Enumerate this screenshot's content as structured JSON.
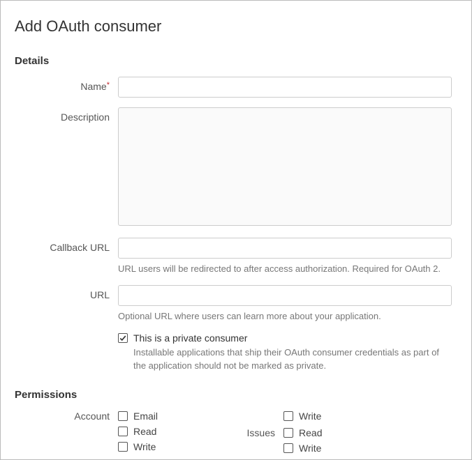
{
  "title": "Add OAuth consumer",
  "sections": {
    "details": {
      "heading": "Details",
      "name": {
        "label": "Name",
        "value": "",
        "required": true
      },
      "description": {
        "label": "Description",
        "value": ""
      },
      "callback_url": {
        "label": "Callback URL",
        "value": "",
        "help": "URL users will be redirected to after access authorization. Required for OAuth 2."
      },
      "url": {
        "label": "URL",
        "value": "",
        "help": "Optional URL where users can learn more about your application."
      },
      "private_consumer": {
        "label": "This is a private consumer",
        "checked": true,
        "help": "Installable applications that ship their OAuth consumer credentials as part of the application should not be marked as private."
      }
    },
    "permissions": {
      "heading": "Permissions",
      "account": {
        "label": "Account",
        "options": {
          "email": "Email",
          "read": "Read",
          "write": "Write"
        }
      },
      "col2_top": {
        "write": "Write"
      },
      "issues": {
        "label": "Issues",
        "options": {
          "read": "Read",
          "write": "Write"
        }
      }
    }
  }
}
